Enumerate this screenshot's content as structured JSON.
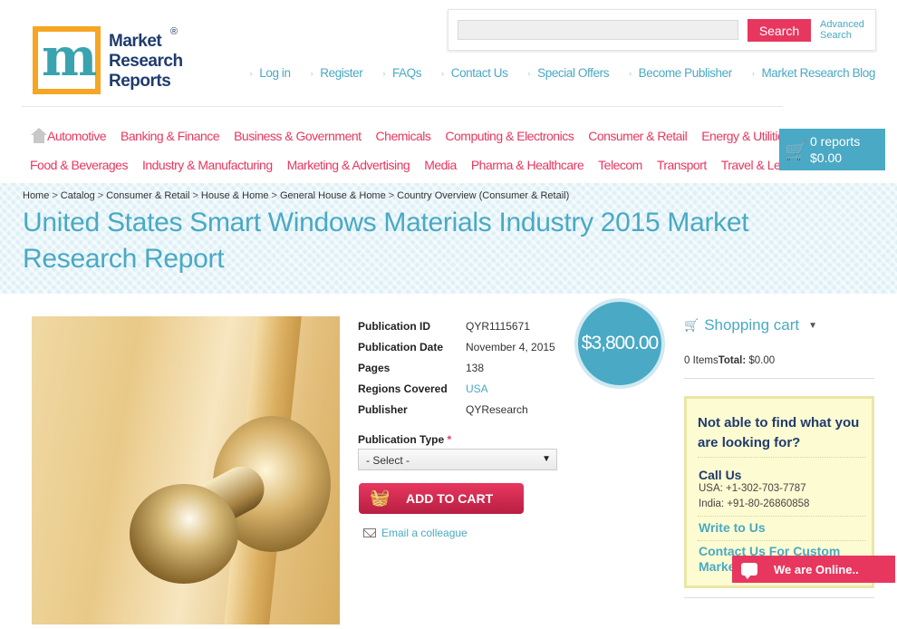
{
  "logo": {
    "line1": "Market",
    "line2": "Research",
    "line3": "Reports",
    "reg": "®",
    "mark": "m"
  },
  "search": {
    "placeholder": "",
    "button": "Search",
    "advanced_line1": "Advanced",
    "advanced_line2": "Search"
  },
  "top_links": [
    "Log in",
    "Register",
    "FAQs",
    "Contact Us",
    "Special Offers",
    "Become Publisher",
    "Market Research Blog"
  ],
  "categories_row1": [
    "Automotive",
    "Banking & Finance",
    "Business & Government",
    "Chemicals",
    "Computing & Electronics",
    "Consumer & Retail",
    "Energy & Utilities"
  ],
  "categories_row2": [
    "Food & Beverages",
    "Industry & Manufacturing",
    "Marketing & Advertising",
    "Media",
    "Pharma & Healthcare",
    "Telecom",
    "Transport",
    "Travel & Leisure"
  ],
  "cart_summary": {
    "reports": "0 reports",
    "total": "$0.00"
  },
  "breadcrumb": [
    "Home",
    "Catalog",
    "Consumer & Retail",
    "House & Home",
    "General House & Home",
    "Country Overview (Consumer & Retail)"
  ],
  "title": "United States Smart Windows Materials Industry 2015 Market Research Report",
  "details": [
    {
      "label": "Publication ID",
      "value": "QYR1115671"
    },
    {
      "label": "Publication Date",
      "value": "November 4, 2015"
    },
    {
      "label": "Pages",
      "value": "138"
    },
    {
      "label": "Regions Covered",
      "value": "USA"
    },
    {
      "label": "Publisher",
      "value": "QYResearch"
    }
  ],
  "price": "$3,800.00",
  "publication_type": {
    "label": "Publication Type",
    "required": "*",
    "selected": "- Select -"
  },
  "add_to_cart": "ADD TO CART",
  "email_colleague": "Email a colleague",
  "shopping_cart": {
    "title": "Shopping cart",
    "items": "0 Items",
    "total_label": "Total:",
    "total": "$0.00"
  },
  "help_box": {
    "question": "Not able to find what you are looking for?",
    "call_us": "Call Us",
    "usa": "USA: +1-302-703-7787",
    "india": "India: +91-80-26860858",
    "write_us": "Write to Us",
    "contact_custom": "Contact Us For Custom Market"
  },
  "chat": "We are Online.."
}
